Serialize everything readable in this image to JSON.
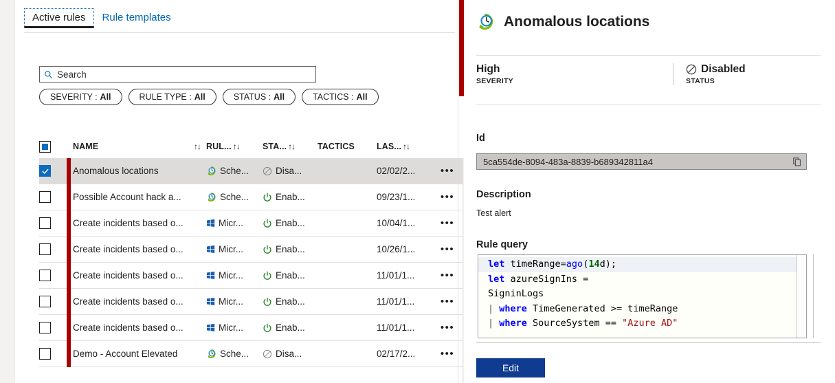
{
  "tabs": [
    {
      "label": "Active rules",
      "active": true
    },
    {
      "label": "Rule templates",
      "active": false
    }
  ],
  "search": {
    "placeholder": "Search",
    "value": "",
    "icon": "search-icon"
  },
  "filters": [
    {
      "label": "SEVERITY :",
      "value": "All"
    },
    {
      "label": "RULE TYPE :",
      "value": "All"
    },
    {
      "label": "STATUS :",
      "value": "All"
    },
    {
      "label": "TACTICS :",
      "value": "All"
    }
  ],
  "table": {
    "columns": [
      {
        "key": "name",
        "label": "NAME",
        "sortable": true,
        "sort_glyph": "↑↓"
      },
      {
        "key": "type",
        "label": "RUL...",
        "sortable": true,
        "sort_glyph": "↑↓"
      },
      {
        "key": "status",
        "label": "STA...",
        "sortable": true,
        "sort_glyph": "↑↓"
      },
      {
        "key": "tactics",
        "label": "TACTICS",
        "sortable": false,
        "sort_glyph": ""
      },
      {
        "key": "last",
        "label": "LAS...",
        "sortable": true,
        "sort_glyph": "↑↓"
      }
    ],
    "rows": [
      {
        "selected": true,
        "name": "Anomalous locations",
        "type": "Sche...",
        "type_icon": "scheduled-clock-icon",
        "status": "Disa...",
        "status_icon": "disabled-icon",
        "tactics": "",
        "last": "02/02/2...",
        "more": "•••"
      },
      {
        "selected": false,
        "name": "Possible Account hack a...",
        "type": "Sche...",
        "type_icon": "scheduled-clock-icon",
        "status": "Enab...",
        "status_icon": "enabled-power-icon",
        "tactics": "",
        "last": "09/23/1...",
        "more": "•••"
      },
      {
        "selected": false,
        "name": "Create incidents based o...",
        "type": "Micr...",
        "type_icon": "microsoft-logo-icon",
        "status": "Enab...",
        "status_icon": "enabled-power-icon",
        "tactics": "",
        "last": "10/04/1...",
        "more": "•••"
      },
      {
        "selected": false,
        "name": "Create incidents based o...",
        "type": "Micr...",
        "type_icon": "microsoft-logo-icon",
        "status": "Enab...",
        "status_icon": "enabled-power-icon",
        "tactics": "",
        "last": "10/26/1...",
        "more": "•••"
      },
      {
        "selected": false,
        "name": "Create incidents based o...",
        "type": "Micr...",
        "type_icon": "microsoft-logo-icon",
        "status": "Enab...",
        "status_icon": "enabled-power-icon",
        "tactics": "",
        "last": "11/01/1...",
        "more": "•••"
      },
      {
        "selected": false,
        "name": "Create incidents based o...",
        "type": "Micr...",
        "type_icon": "microsoft-logo-icon",
        "status": "Enab...",
        "status_icon": "enabled-power-icon",
        "tactics": "",
        "last": "11/01/1...",
        "more": "•••"
      },
      {
        "selected": false,
        "name": "Create incidents based o...",
        "type": "Micr...",
        "type_icon": "microsoft-logo-icon",
        "status": "Enab...",
        "status_icon": "enabled-power-icon",
        "tactics": "",
        "last": "11/01/1...",
        "more": "•••"
      },
      {
        "selected": false,
        "name": "Demo - Account Elevated",
        "type": "Sche...",
        "type_icon": "scheduled-clock-icon",
        "status": "Disa...",
        "status_icon": "disabled-icon",
        "tactics": "",
        "last": "02/17/2...",
        "more": "•••"
      }
    ]
  },
  "detail": {
    "title": "Anomalous locations",
    "title_icon": "scheduled-clock-icon",
    "severity": {
      "value": "High",
      "label": "SEVERITY",
      "color": "#a80000"
    },
    "status": {
      "value": "Disabled",
      "label": "STATUS",
      "icon": "disabled-icon"
    },
    "id": {
      "label": "Id",
      "value": "5ca554de-8094-483a-8839-b689342811a4",
      "copy_icon": "copy-icon"
    },
    "description": {
      "label": "Description",
      "value": "Test alert"
    },
    "rule_query": {
      "label": "Rule query",
      "lines": [
        {
          "highlight": true,
          "tokens": [
            {
              "t": "kw",
              "v": "let"
            },
            {
              "t": "p",
              "v": " timeRange="
            },
            {
              "t": "fn",
              "v": "ago"
            },
            {
              "t": "p",
              "v": "("
            },
            {
              "t": "num",
              "v": "14"
            },
            {
              "t": "p",
              "v": "d);"
            }
          ]
        },
        {
          "highlight": false,
          "tokens": [
            {
              "t": "kw",
              "v": "let"
            },
            {
              "t": "p",
              "v": " azureSignIns ="
            }
          ]
        },
        {
          "highlight": false,
          "tokens": [
            {
              "t": "p",
              "v": "SigninLogs"
            }
          ]
        },
        {
          "highlight": false,
          "tokens": [
            {
              "t": "pipe",
              "v": "| "
            },
            {
              "t": "kw",
              "v": "where"
            },
            {
              "t": "p",
              "v": " TimeGenerated >= timeRange"
            }
          ]
        },
        {
          "highlight": false,
          "tokens": [
            {
              "t": "pipe",
              "v": "| "
            },
            {
              "t": "kw",
              "v": "where"
            },
            {
              "t": "p",
              "v": " SourceSystem == "
            },
            {
              "t": "str",
              "v": "\"Azure AD\""
            }
          ]
        }
      ]
    },
    "edit_button": "Edit"
  },
  "colors": {
    "severity_high": "#a80000",
    "accent_blue": "#0f6cbd",
    "link_blue": "#0067b8",
    "edit_button": "#0f3c91",
    "enabled_green": "#107c10",
    "selected_row": "#dedcda"
  }
}
